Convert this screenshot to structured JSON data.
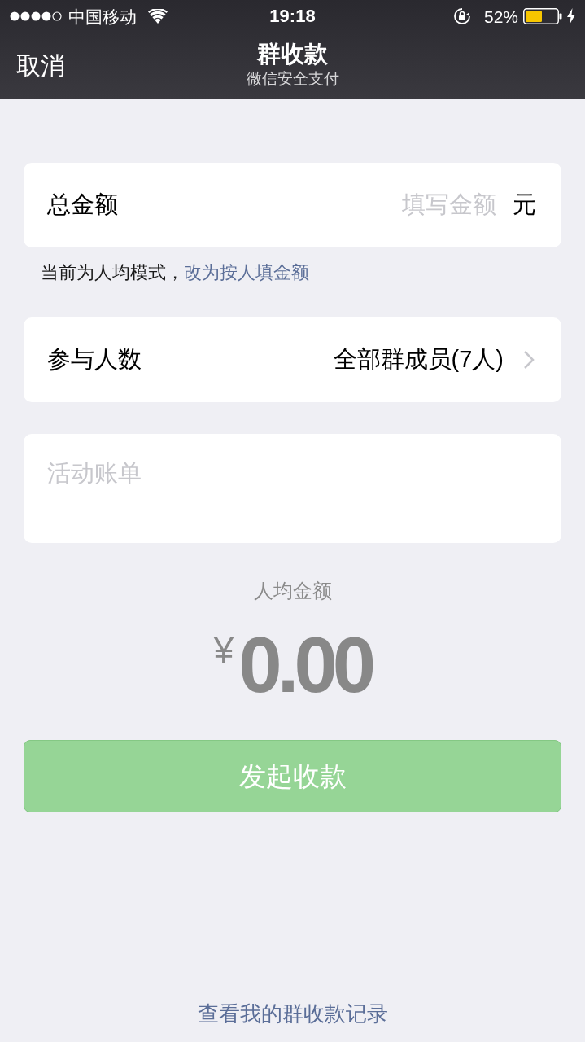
{
  "status_bar": {
    "carrier": "中国移动",
    "time": "19:18",
    "battery": "52%"
  },
  "nav": {
    "cancel": "取消",
    "title": "群收款",
    "subtitle": "微信安全支付"
  },
  "total_amount": {
    "label": "总金额",
    "placeholder": "填写金额",
    "unit": "元"
  },
  "mode_hint": {
    "text": "当前为人均模式，",
    "link": "改为按人填金额"
  },
  "participants": {
    "label": "参与人数",
    "value": "全部群成员(7人)"
  },
  "note": {
    "placeholder": "活动账单"
  },
  "per_person": {
    "label": "人均金额",
    "currency": "¥",
    "amount": "0.00"
  },
  "submit": {
    "label": "发起收款",
    "disabled": true
  },
  "records_link": "查看我的群收款记录"
}
